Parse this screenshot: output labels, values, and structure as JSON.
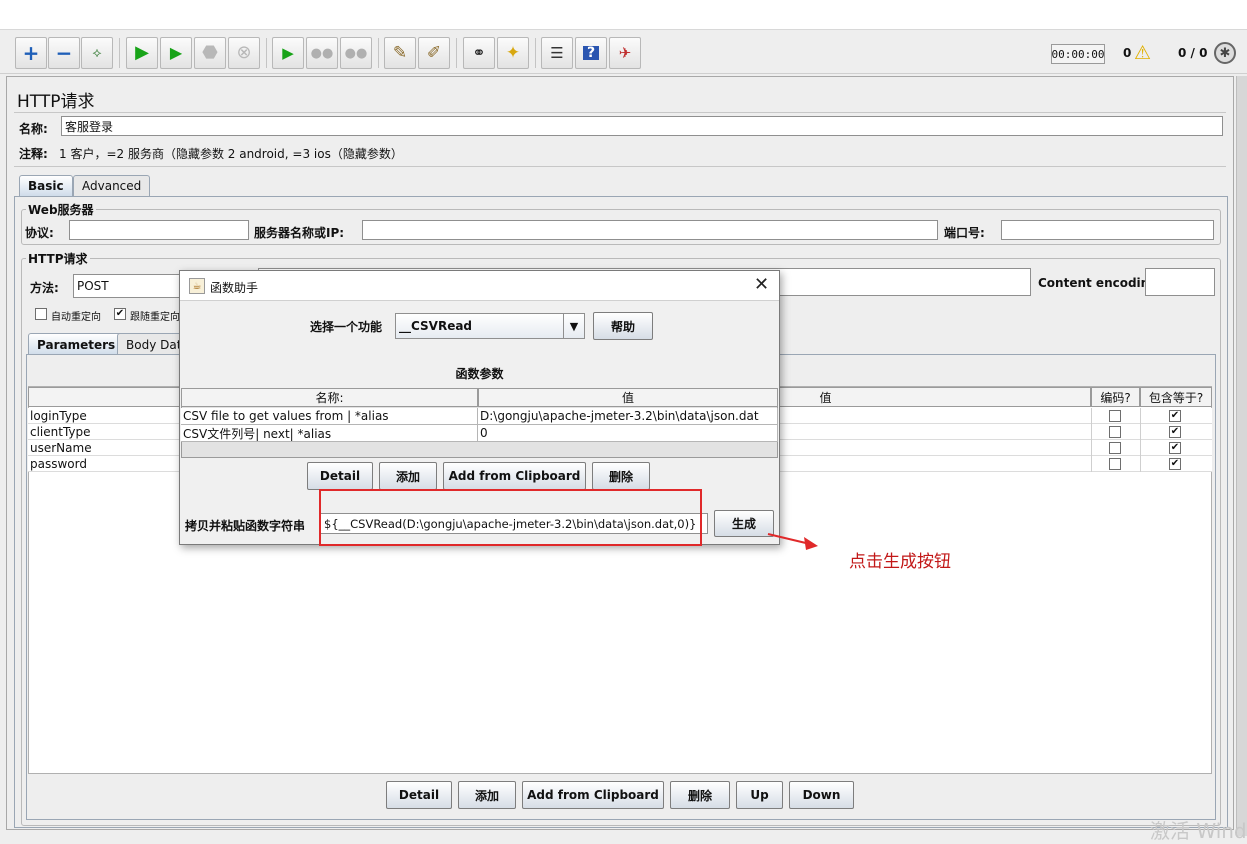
{
  "toolbar": {
    "timer": "00:00:00",
    "warn_count": "0",
    "threads": "0 / 0",
    "icons": [
      "add-icon",
      "remove-icon",
      "toggle-icon",
      "start-icon",
      "start-no-pause-icon",
      "stop-icon",
      "shutdown-icon",
      "remote-start-icon",
      "remote-stop-icon",
      "remote-shutdown-icon",
      "clear-icon",
      "clear-all-icon",
      "search-icon",
      "reset-search-icon",
      "function-helper-icon",
      "help-icon",
      "remote-exit-icon"
    ]
  },
  "http_request": {
    "panel_title": "HTTP请求",
    "name_label": "名称:",
    "name_value": "客服登录",
    "comment_label": "注释:",
    "comment_value": "1 客户，=2 服务商（隐藏参数 2 android, =3 ios（隐藏参数）",
    "tabs": [
      {
        "label": "Basic"
      },
      {
        "label": "Advanced"
      }
    ],
    "web_server": {
      "legend": "Web服务器",
      "protocol_label": "协议:",
      "server_label": "服务器名称或IP:",
      "port_label": "端口号:"
    },
    "request": {
      "legend": "HTTP请求",
      "method_label": "方法:",
      "method_value": "POST",
      "encoding_label": "Content encoding:",
      "auto_redirect": "自动重定向",
      "follow_redirect": "跟随重定向"
    },
    "param_tabs": [
      {
        "label": "Parameters"
      },
      {
        "label": "Body Data"
      }
    ],
    "params_table": {
      "value_header": "值",
      "encode_header": "编码?",
      "include_header": "包含等于?",
      "rows": [
        {
          "name": "loginType"
        },
        {
          "name": "clientType"
        },
        {
          "name": "userName"
        },
        {
          "name": "password"
        }
      ]
    },
    "buttons": {
      "detail": "Detail",
      "add": "添加",
      "add_clipboard": "Add from Clipboard",
      "delete": "删除",
      "up": "Up",
      "down": "Down"
    }
  },
  "function_dialog": {
    "title": "函数助手",
    "select_label": "选择一个功能",
    "function_value": "__CSVRead",
    "help_button": "帮助",
    "params_title": "函数参数",
    "col_name": "名称:",
    "col_value": "值",
    "rows": [
      {
        "name": "CSV file to get values from | *alias",
        "value": "D:\\gongju\\apache-jmeter-3.2\\bin\\data\\json.dat"
      },
      {
        "name": "CSV文件列号| next| *alias",
        "value": "0"
      }
    ],
    "buttons": {
      "detail": "Detail",
      "add": "添加",
      "add_clipboard": "Add from Clipboard",
      "delete": "删除"
    },
    "output_label": "拷贝并粘贴函数字符串",
    "output_value": "${__CSVRead(D:\\gongju\\apache-jmeter-3.2\\bin\\data\\json.dat,0)}",
    "generate_button": "生成"
  },
  "annotation": {
    "text": "点击生成按钮",
    "color": "#c21818"
  },
  "watermark": "激活 Wind"
}
